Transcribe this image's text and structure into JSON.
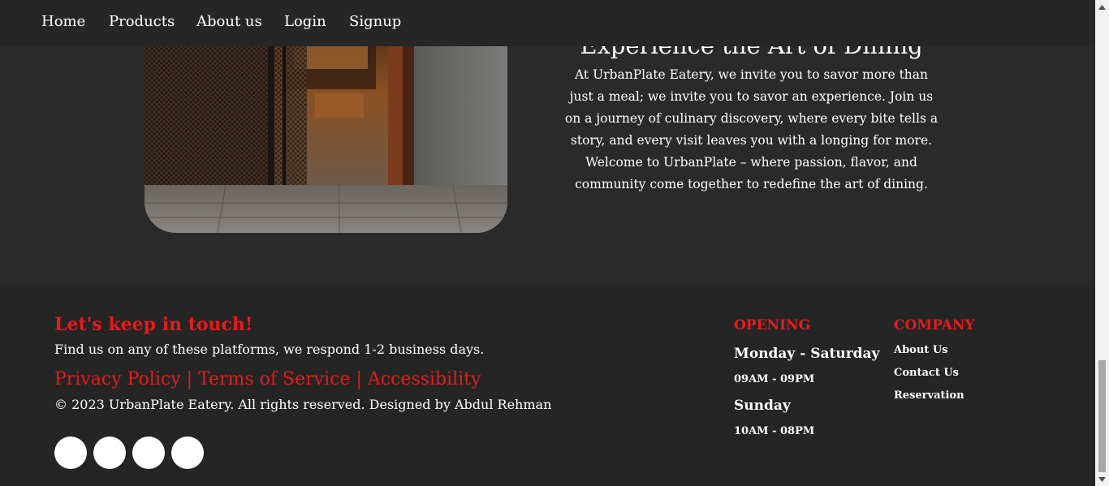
{
  "nav": {
    "items": [
      {
        "label": "Home"
      },
      {
        "label": "Products"
      },
      {
        "label": "About us"
      },
      {
        "label": "Login"
      },
      {
        "label": "Signup"
      }
    ]
  },
  "about": {
    "title": "Experience the Art of Dining",
    "text": "At UrbanPlate Eatery, we invite you to savor more than just a meal; we invite you to savor an experience. Join us on a journey of culinary discovery, where every bite tells a story, and every visit leaves you with a longing for more. Welcome to UrbanPlate – where passion, flavor, and community come together to redefine the art of dining."
  },
  "footer": {
    "touch_title": "Let's keep in touch!",
    "touch_sub": "Find us on any of these platforms, we respond 1-2 business days.",
    "legal": {
      "privacy": "Privacy Policy",
      "terms": "Terms of Service",
      "accessibility": "Accessibility",
      "separator": " | "
    },
    "copyright": "© 2023 UrbanPlate Eatery. All rights reserved. Designed by Abdul Rehman",
    "opening": {
      "title": "OPENING",
      "weekday_label": "Monday - Saturday",
      "weekday_hours": "09AM - 09PM",
      "sunday_label": "Sunday",
      "sunday_hours": "10AM - 08PM"
    },
    "company": {
      "title": "COMPANY",
      "links": [
        "About Us",
        "Contact Us",
        "Reservation"
      ]
    }
  },
  "colors": {
    "accent": "#e51b1b",
    "page_bg": "#2a2a2a",
    "footer_bg": "#252525",
    "nav_bg": "#262626"
  }
}
